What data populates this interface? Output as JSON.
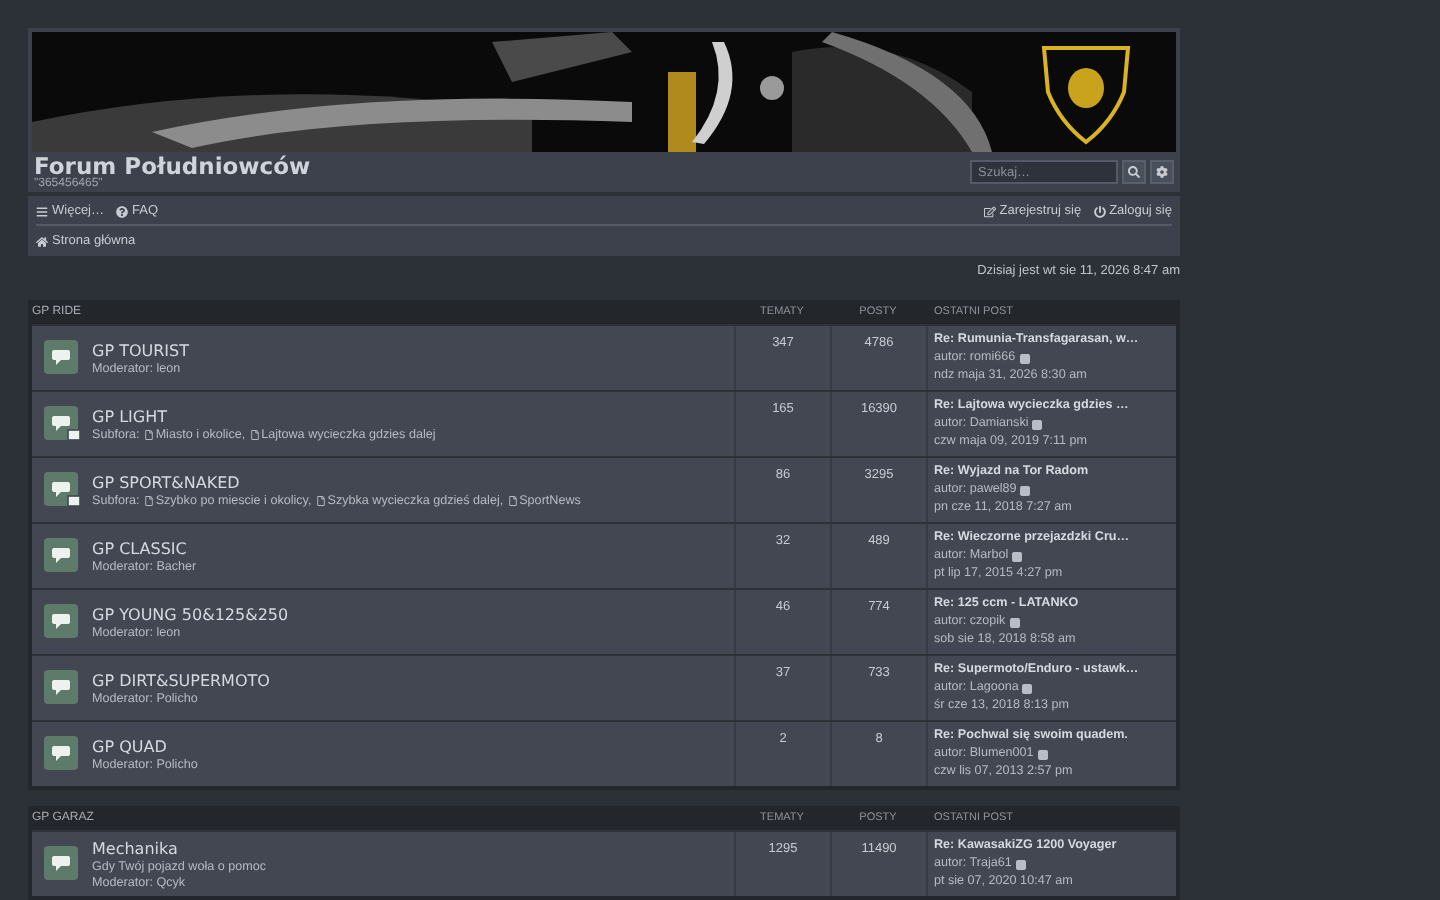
{
  "header": {
    "title": "Forum Południowców",
    "subtitle": "\"365456465\"",
    "search": {
      "placeholder": "Szukaj…"
    }
  },
  "nav": {
    "left": [
      {
        "label": "Więcej…"
      },
      {
        "label": "FAQ"
      }
    ],
    "right": [
      {
        "label": "Zarejestruj się"
      },
      {
        "label": "Zaloguj się"
      }
    ],
    "breadcrumb": "Strona główna"
  },
  "date": "Dzisiaj jest wt sie 11, 2026 8:47 am",
  "categories": [
    {
      "name": "GP RIDE",
      "columns": [
        "TEMATY",
        "POSTY",
        "OSTATNI POST"
      ],
      "forums": [
        {
          "name": "GP TOURIST",
          "moderator": "Moderator: leon",
          "topics": "347",
          "posts": "4786",
          "last": {
            "title": "Re: Rumunia-Transfagarasan, w…",
            "author": "autor: romi666",
            "date": "ndz maja 31, 2026 8:30 am"
          }
        },
        {
          "name": "GP LIGHT",
          "subforums_label": "Subfora:",
          "subforums": [
            "Miasto i okolice,",
            "Lajtowa wycieczka gdzies dalej"
          ],
          "topics": "165",
          "posts": "16390",
          "last": {
            "title": "Re: Lajtowa wycieczka gdzies …",
            "author": "autor: Damianski",
            "date": "czw maja 09, 2019 7:11 pm"
          }
        },
        {
          "name": "GP SPORT&NAKED",
          "subforums_label": "Subfora:",
          "subforums": [
            "Szybko po miescie i okolicy,",
            "Szybka wycieczka gdzieś dalej,",
            "SportNews"
          ],
          "topics": "86",
          "posts": "3295",
          "last": {
            "title": "Re: Wyjazd na Tor Radom",
            "author": "autor: pawel89",
            "date": "pn cze 11, 2018 7:27 am"
          }
        },
        {
          "name": "GP CLASSIC",
          "moderator": "Moderator: Bacher",
          "topics": "32",
          "posts": "489",
          "last": {
            "title": "Re: Wieczorne przejazdzki Cru…",
            "author": "autor: Marbol",
            "date": "pt lip 17, 2015 4:27 pm"
          }
        },
        {
          "name": "GP YOUNG 50&125&250",
          "moderator": "Moderator: leon",
          "topics": "46",
          "posts": "774",
          "last": {
            "title": "Re: 125 ccm - LATANKO",
            "author": "autor: czopik",
            "date": "sob sie 18, 2018 8:58 am"
          }
        },
        {
          "name": "GP DIRT&SUPERMOTO",
          "moderator": "Moderator: Policho",
          "topics": "37",
          "posts": "733",
          "last": {
            "title": "Re: Supermoto/Enduro - ustawk…",
            "author": "autor: Lagoona",
            "date": "śr cze 13, 2018 8:13 pm"
          }
        },
        {
          "name": "GP QUAD",
          "moderator": "Moderator: Policho",
          "topics": "2",
          "posts": "8",
          "last": {
            "title": "Re: Pochwal się swoim quadem.",
            "author": "autor: Blumen001",
            "date": "czw lis 07, 2013 2:57 pm"
          }
        }
      ]
    },
    {
      "name": "GP GARAZ",
      "columns": [
        "TEMATY",
        "POSTY",
        "OSTATNI POST"
      ],
      "forums": [
        {
          "name": "Mechanika",
          "description": "Gdy Twój pojazd woła o pomoc",
          "moderator": "Moderator: Qcyk",
          "topics": "1295",
          "posts": "11490",
          "last": {
            "title": "Re: KawasakiZG 1200 Voyager",
            "author": "autor: Traja61",
            "date": "pt sie 07, 2020 10:47 am"
          }
        }
      ]
    }
  ]
}
